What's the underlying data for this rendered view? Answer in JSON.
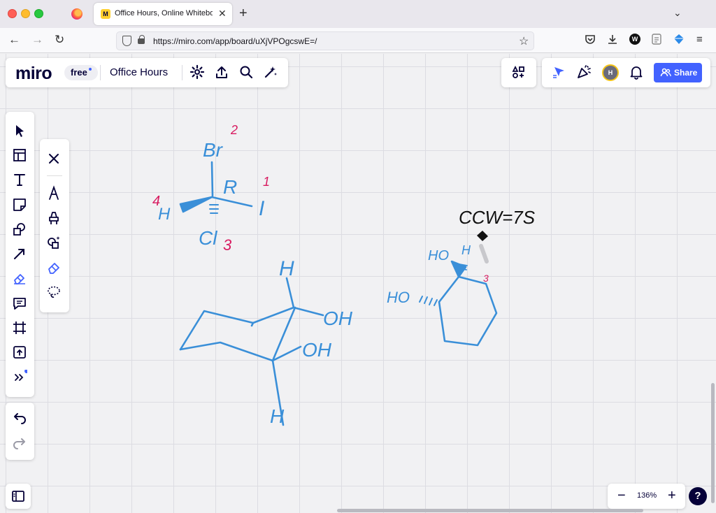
{
  "browser": {
    "tab_title": "Office Hours, Online Whiteboard",
    "tab_favicon_text": "M",
    "url": "https://miro.com/app/board/uXjVPOgcswE=/",
    "ext_badge": "W"
  },
  "miro": {
    "logo": "miro",
    "plan": "free",
    "board_title": "Office Hours",
    "avatar_initial": "H",
    "share_label": "Share",
    "zoom_level": "136%",
    "help_label": "?"
  },
  "drawing_labels": {
    "br": "Br",
    "br_priority": "2",
    "r_descriptor": "R",
    "i_priority": "1",
    "i": "I",
    "h_priority": "4",
    "h": "H",
    "cl": "Cl",
    "cl_priority": "3",
    "ccw_note": "CCW=7S",
    "ho_top": "HO",
    "h_small": "H",
    "ring_priority": "3",
    "ho_left": "HO",
    "chair_h_top": "H",
    "oh_top": "OH",
    "oh_bottom": "OH",
    "chair_h_bottom": "H"
  },
  "colors": {
    "ink_blue": "#3a8fd8",
    "ink_red": "#d81b60",
    "ink_black": "#111111",
    "accent": "#4262ff"
  }
}
